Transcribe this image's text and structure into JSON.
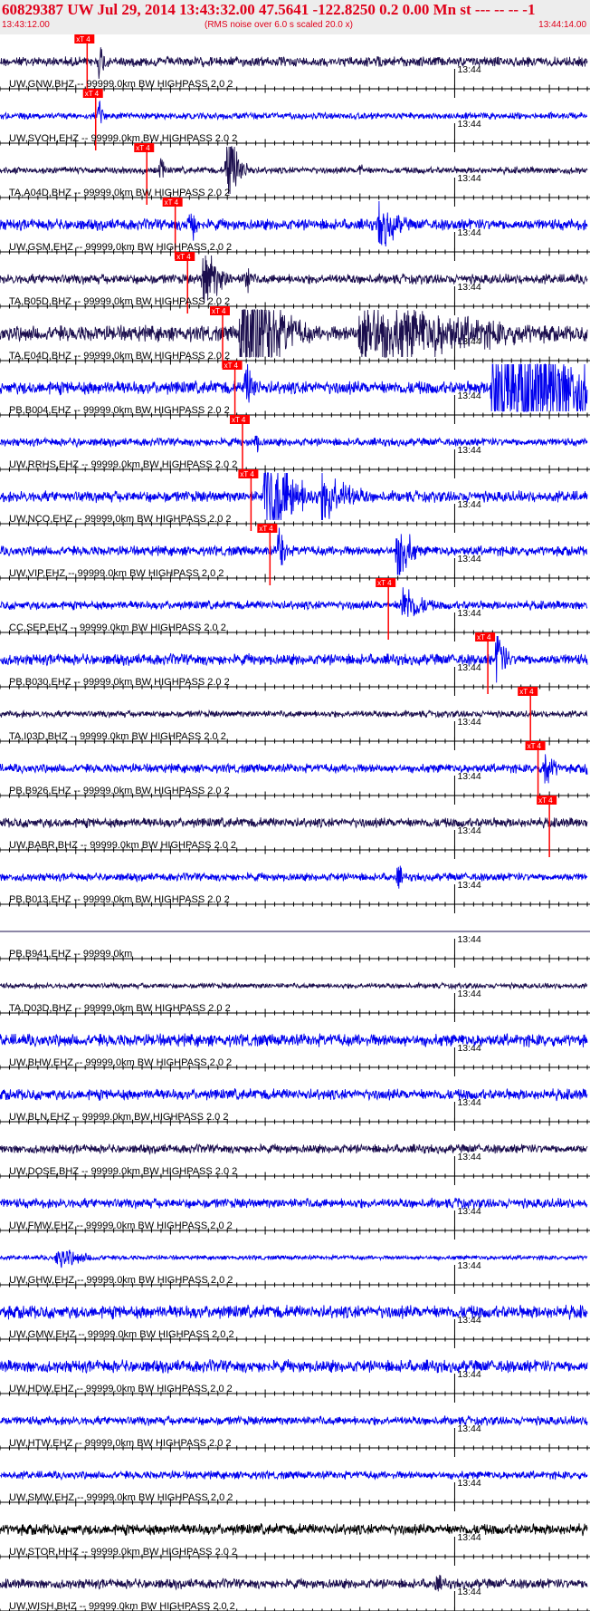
{
  "header": {
    "title": "60829387 UW Jul 29, 2014 13:43:32.00   47.5641 -122.8250  0.2 0.00 Mn st --- -- --   -1",
    "start_time": "13:43:12.00",
    "rms_note": "(RMS noise over 6.0 s scaled 20.0 x)",
    "end_time": "13:44:14.00",
    "title_color": "#e0001a"
  },
  "chart_data": {
    "type": "line",
    "title": "60829387 UW Jul 29, 2014 13:43:32.00   47.5641 -122.8250  0.2 0.00 Mn st --- -- --   -1",
    "x_range": [
      "13:43:12.00",
      "13:44:14.00"
    ],
    "x_start_seconds": 0,
    "x_end_seconds": 62,
    "minute_mark_label": "13:44",
    "minute_mark_seconds": 48,
    "pick_label": "xT 4",
    "pick_color": "#ff0000",
    "colors": {
      "dark": "#1a0d4d",
      "blue": "#0000ee",
      "black": "#000000",
      "grid": "#000000"
    },
    "traces": [
      {
        "label": "UW,GNW,BHZ -- 99999.0km BW  HIGHPASS  2.0  2",
        "color": "dark",
        "pick": 9.2,
        "amp": 0.22,
        "events": [
          [
            10.5,
            1.0,
            0.8
          ],
          [
            40.0,
            0.5,
            0.3
          ]
        ]
      },
      {
        "label": "UW,SVOH,EHZ -- 99999.0km BW  HIGHPASS  2.0  2",
        "color": "blue",
        "pick": 10.1,
        "amp": 0.15,
        "events": [
          [
            10.5,
            0.7,
            0.6
          ]
        ]
      },
      {
        "label": "TA,A04D,BHZ -- 99999.0km BW  HIGHPASS  2.0  2",
        "color": "dark",
        "pick": 15.5,
        "amp": 0.15,
        "events": [
          [
            17.0,
            0.8,
            0.5
          ],
          [
            24.0,
            3.0,
            1.0
          ],
          [
            38.0,
            0.6,
            0.3
          ]
        ]
      },
      {
        "label": "UW,GSM,EHZ -- 99999.0km BW  HIGHPASS  2.0  2",
        "color": "blue",
        "pick": 18.5,
        "amp": 0.25,
        "events": [
          [
            20.0,
            1.5,
            0.6
          ],
          [
            40.0,
            1.4,
            2.0
          ]
        ]
      },
      {
        "label": "TA,B05D,BHZ -- 99999.0km BW  HIGHPASS  2.0  2",
        "color": "dark",
        "pick": 19.8,
        "amp": 0.22,
        "events": [
          [
            21.5,
            2.0,
            1.5
          ],
          [
            26.0,
            1.2,
            0.5
          ]
        ]
      },
      {
        "label": "TA,E04D,BHZ -- 99999.0km BW  HIGHPASS  2.0  2",
        "color": "dark",
        "pick": 23.5,
        "amp": 0.35,
        "events": [
          [
            25.5,
            5.0,
            3.0
          ],
          [
            38.0,
            2.0,
            12.0
          ]
        ]
      },
      {
        "label": "PB,B004,EHZ -- 99999.0km BW  HIGHPASS  2.0  2",
        "color": "blue",
        "pick": 24.8,
        "amp": 0.3,
        "events": [
          [
            26.0,
            1.5,
            1.0
          ],
          [
            52.0,
            3.5,
            10.0
          ]
        ]
      },
      {
        "label": "UW,RRHS,EHZ -- 99999.0km BW  HIGHPASS  2.0  2",
        "color": "blue",
        "pick": 25.6,
        "amp": 0.18,
        "events": [
          [
            8.0,
            0.4,
            0.5
          ],
          [
            27.0,
            0.7,
            0.5
          ]
        ]
      },
      {
        "label": "UW,NCO,EHZ -- 99999.0km BW  HIGHPASS  2.0  2",
        "color": "blue",
        "pick": 26.5,
        "amp": 0.25,
        "events": [
          [
            28.0,
            3.5,
            2.5
          ],
          [
            34.0,
            1.5,
            3.0
          ]
        ]
      },
      {
        "label": "UW,VIP,EHZ -- 99999.0km BW  HIGHPASS  2.0  2",
        "color": "blue",
        "pick": 28.5,
        "amp": 0.22,
        "events": [
          [
            29.5,
            1.6,
            0.6
          ],
          [
            42.0,
            2.6,
            1.0
          ]
        ]
      },
      {
        "label": "CC,SEP,EHZ -- 99999.0km BW  HIGHPASS  2.0  2",
        "color": "blue",
        "pick": 41.0,
        "amp": 0.2,
        "events": [
          [
            42.5,
            1.2,
            2.0
          ]
        ]
      },
      {
        "label": "PB,B030,EHZ -- 99999.0km BW  HIGHPASS  2.0  2",
        "color": "blue",
        "pick": 51.5,
        "amp": 0.25,
        "events": [
          [
            52.5,
            1.8,
            0.8
          ]
        ]
      },
      {
        "label": "TA,I03D,BHZ -- 99999.0km BW  HIGHPASS  2.0  2",
        "color": "dark",
        "pick": 56.0,
        "amp": 0.15,
        "events": []
      },
      {
        "label": "PB,B926,EHZ -- 99999.0km BW  HIGHPASS  2.0  2",
        "color": "blue",
        "pick": 56.8,
        "amp": 0.2,
        "events": [
          [
            57.5,
            1.2,
            1.0
          ],
          [
            62.0,
            1.0,
            0.5
          ]
        ]
      },
      {
        "label": "UW,BABR,BHZ -- 99999.0km BW  HIGHPASS  2.0  2",
        "color": "dark",
        "pick": 58.0,
        "amp": 0.22,
        "events": []
      },
      {
        "label": "PB,B013,EHZ -- 99999.0km BW  HIGHPASS  2.0  2",
        "color": "blue",
        "pick": null,
        "amp": 0.18,
        "events": [
          [
            42.0,
            0.8,
            0.5
          ]
        ]
      },
      {
        "label": "PB,B941,EHZ -- 99999.0km",
        "color": "dark",
        "pick": null,
        "amp": 0.0,
        "events": []
      },
      {
        "label": "TA,D03D,BHZ -- 99999.0km BW  HIGHPASS  2.0  2",
        "color": "dark",
        "pick": null,
        "amp": 0.12,
        "events": []
      },
      {
        "label": "UW,BHW,EHZ -- 99999.0km BW  HIGHPASS  2.0  2",
        "color": "blue",
        "pick": null,
        "amp": 0.28,
        "events": []
      },
      {
        "label": "UW,BLN,EHZ -- 99999.0km BW  HIGHPASS  2.0  2",
        "color": "blue",
        "pick": null,
        "amp": 0.25,
        "events": []
      },
      {
        "label": "UW,DOSE,BHZ -- 99999.0km BW  HIGHPASS  2.0  2",
        "color": "dark",
        "pick": null,
        "amp": 0.2,
        "events": []
      },
      {
        "label": "UW,FMW,EHZ -- 99999.0km BW  HIGHPASS  2.0  2",
        "color": "blue",
        "pick": null,
        "amp": 0.22,
        "events": [
          [
            48.5,
            0.6,
            0.4
          ]
        ]
      },
      {
        "label": "UW,GHW,EHZ -- 99999.0km BW  HIGHPASS  2.0  2",
        "color": "blue",
        "pick": null,
        "amp": 0.1,
        "events": [
          [
            6.0,
            0.6,
            3.0
          ]
        ]
      },
      {
        "label": "UW,GMW,EHZ -- 99999.0km BW  HIGHPASS  2.0  2",
        "color": "blue",
        "pick": null,
        "amp": 0.3,
        "events": []
      },
      {
        "label": "UW,HDW,EHZ -- 99999.0km BW  HIGHPASS  2.0  2",
        "color": "blue",
        "pick": null,
        "amp": 0.28,
        "events": []
      },
      {
        "label": "UW,HTW,EHZ -- 99999.0km BW  HIGHPASS  2.0  2",
        "color": "blue",
        "pick": null,
        "amp": 0.2,
        "events": []
      },
      {
        "label": "UW,SMW,EHZ -- 99999.0km BW  HIGHPASS  2.0  2",
        "color": "blue",
        "pick": null,
        "amp": 0.18,
        "events": []
      },
      {
        "label": "UW,STOR,HHZ -- 99999.0km BW  HIGHPASS  2.0  2",
        "color": "black",
        "pick": null,
        "amp": 0.25,
        "events": []
      },
      {
        "label": "UW,WISH,BHZ -- 99999.0km BW  HIGHPASS  2.0  2",
        "color": "dark",
        "pick": null,
        "amp": 0.22,
        "events": [
          [
            46.0,
            0.5,
            1.5
          ]
        ]
      }
    ]
  }
}
